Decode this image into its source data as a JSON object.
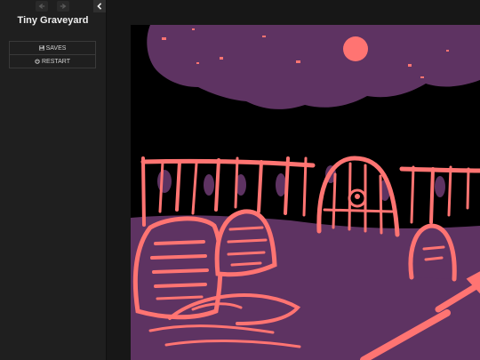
{
  "story": {
    "title": "Tiny Graveyard"
  },
  "menu": {
    "saves_label": "SAVES",
    "restart_label": "RESTART"
  },
  "colors": {
    "sidebar_bg": "#1f1f1f",
    "page_bg": "#171717",
    "sky": "#000000",
    "purple": "#5e3362",
    "coral": "#ff7472"
  }
}
